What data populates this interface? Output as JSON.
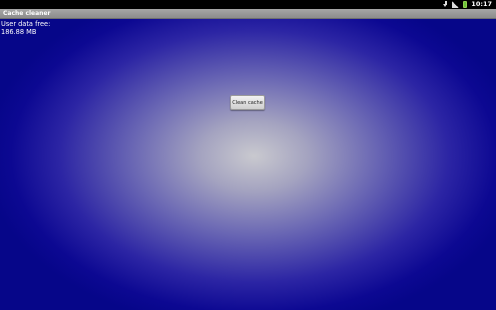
{
  "status_bar": {
    "time": "10:17",
    "icons": [
      "download-icon",
      "signal-icon",
      "battery-icon"
    ],
    "battery_color": "#6cc33a"
  },
  "app": {
    "title": "Cache cleaner"
  },
  "main": {
    "data_label": "User data free:",
    "data_value": "186.88 MB",
    "clean_button_label": "Clean cache"
  },
  "colors": {
    "gradient_center": "#c9c9cf",
    "gradient_edge": "#060689"
  }
}
